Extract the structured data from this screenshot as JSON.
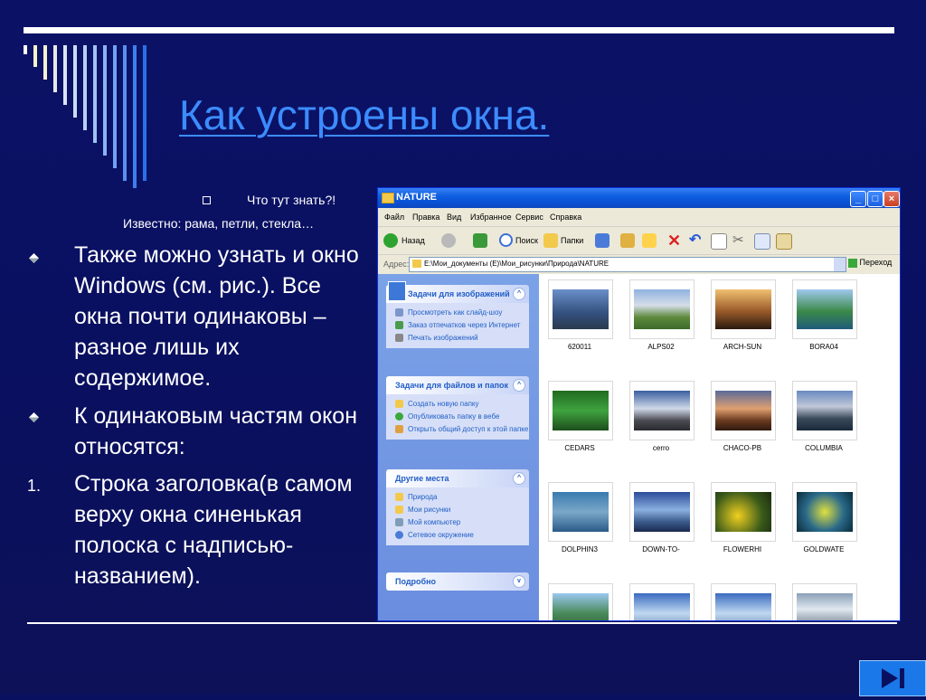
{
  "slide": {
    "title": "Как устроены окна.",
    "sub_bullet": "Что тут знать?!",
    "sub_line": "Известно: рама, петли, стекла…",
    "bullets": [
      {
        "text": "Также можно узнать и окно Windows (см. рис.). Все окна почти одинаковы – разное лишь их содержимое."
      },
      {
        "text": "К одинаковым частям окон относятся:"
      }
    ],
    "numbered": [
      {
        "num": "1.",
        "text": "Строка заголовка(в самом верху окна синенькая полоска с надписью-названием)."
      }
    ]
  },
  "window": {
    "title": "NATURE",
    "menu": [
      "Файл",
      "Правка",
      "Вид",
      "Избранное",
      "Сервис",
      "Справка"
    ],
    "toolbar": {
      "back": "Назад",
      "search": "Поиск",
      "folders": "Папки"
    },
    "address": {
      "label": "Адрес:",
      "path": "E:\\Мои_документы (E)\\Мои_рисунки\\Природа\\NATURE",
      "go": "Переход"
    },
    "panels": [
      {
        "title": "Задачи для изображений",
        "items": [
          "Просмотреть как слайд-шоу",
          "Заказ отпечатков через Интернет",
          "Печать изображений"
        ]
      },
      {
        "title": "Задачи для файлов и папок",
        "items": [
          "Создать новую папку",
          "Опубликовать папку в вебе",
          "Открыть общий доступ к этой папке"
        ]
      },
      {
        "title": "Другие места",
        "items": [
          "Природа",
          "Мои рисунки",
          "Мой компьютер",
          "Сетевое окружение"
        ]
      },
      {
        "title": "Подробно",
        "items": []
      }
    ],
    "files": [
      "620011",
      "ALPS02",
      "ARCH-SUN",
      "BORA04",
      "CEDARS",
      "cerro",
      "CHACO-PB",
      "COLUMBIA",
      "DOLPHIN3",
      "DOWN-TO-",
      "FLOWERHI",
      "GOLDWATE",
      "",
      "",
      "",
      ""
    ]
  },
  "colors": {
    "background": "#0a1060",
    "title": "#3c8cff",
    "titlebar": "#0a52d6"
  }
}
